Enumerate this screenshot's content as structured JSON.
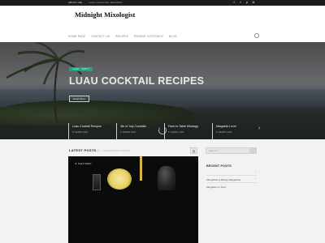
{
  "topbar": {
    "about": "ABOUT ME",
    "tagline": "LUAU COCKTAIL RECIPES",
    "social": [
      {
        "icon": "facebook-icon",
        "glyph": "f"
      },
      {
        "icon": "twitter-icon",
        "glyph": "t"
      },
      {
        "icon": "pinterest-icon",
        "glyph": "p"
      },
      {
        "icon": "instagram-icon",
        "glyph": "◘"
      }
    ]
  },
  "header": {
    "logo": "Midnight Mixologist",
    "nav": [
      "HOME PAGE",
      "CONTACT US",
      "RECIPES",
      "PAIRING COCKTAILS",
      "BLOG"
    ]
  },
  "hero": {
    "badge": "LUAU · PARTY",
    "title": "LUAU COCKTAIL RECIPES",
    "read_more": "Read More"
  },
  "slider": [
    {
      "title": "Luau Cocktail Recipes",
      "date": "5 YEARS AGO"
    },
    {
      "title": "4th of July Cocktails",
      "date": "5 YEARS AGO"
    },
    {
      "title": "Farm to Table Mixology",
      "date": "5 YEARS AGO"
    },
    {
      "title": "Margarita Love!",
      "date": "5 YEARS AGO"
    }
  ],
  "latest": {
    "title": "LATEST POSTS",
    "subtitle": "LUAU · QUENCHING SOUND",
    "post_category": "★ FEATURED"
  },
  "sidebar": {
    "search_placeholder": "Search ...",
    "recent_title": "RECENT POSTS",
    "recent_items": [
      "Margaritas & Mango Margaritas",
      "Margarita vs Tonic"
    ]
  },
  "colors": {
    "topbar": "#1c1c1c",
    "accent": "#1aa38a",
    "band": "#f2f2f2"
  }
}
